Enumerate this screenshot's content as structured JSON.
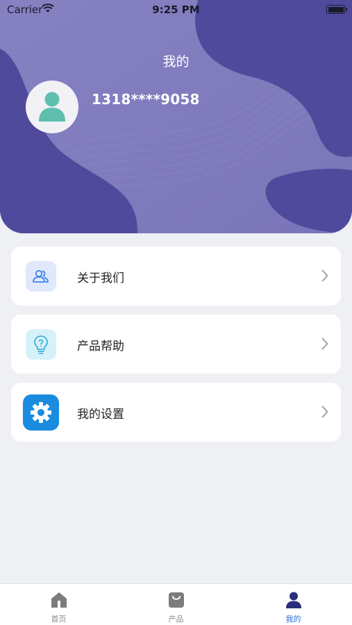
{
  "status_bar": {
    "carrier": "Carrier",
    "time": "9:25 PM"
  },
  "header": {
    "title": "我的",
    "username": "1318****9058"
  },
  "menu": [
    {
      "label": "关于我们",
      "icon": "people-icon"
    },
    {
      "label": "产品帮助",
      "icon": "lightbulb-question-icon"
    },
    {
      "label": "我的设置",
      "icon": "gear-icon"
    }
  ],
  "tabs": [
    {
      "label": "首页",
      "icon": "home-icon",
      "active": false
    },
    {
      "label": "产品",
      "icon": "shopping-bag-icon",
      "active": false
    },
    {
      "label": "我的",
      "icon": "person-icon",
      "active": true
    }
  ],
  "colors": {
    "header_bg": "#7e79bb",
    "header_blob": "#4f4a9c",
    "active_tab": "#2e6fd6",
    "page_bg": "#eff0f4"
  }
}
